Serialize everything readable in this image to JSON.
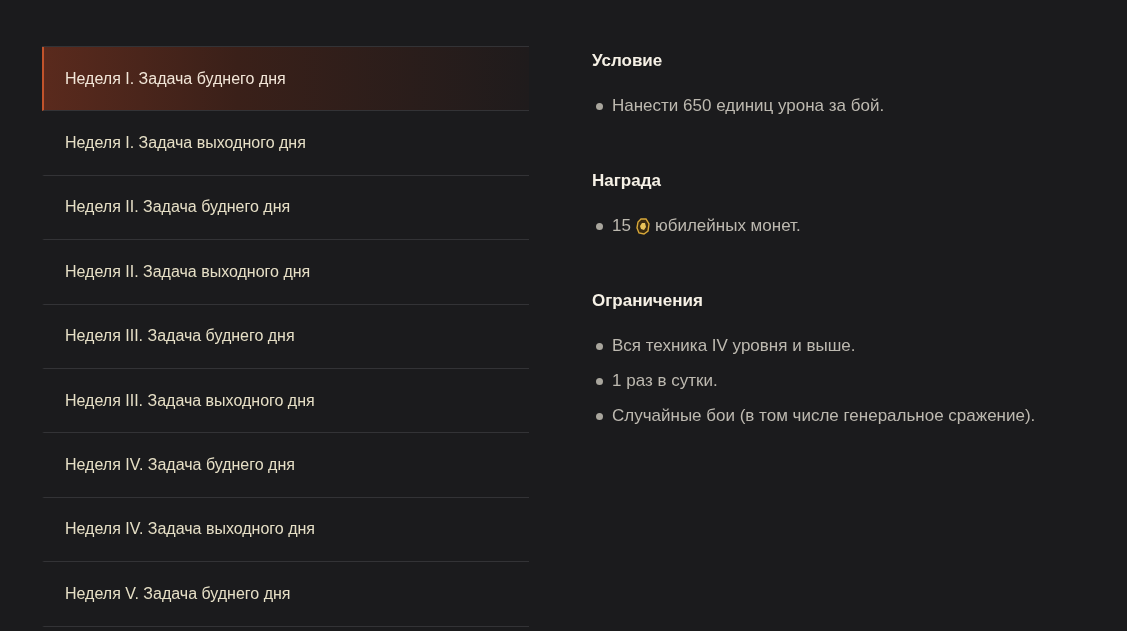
{
  "tasks": [
    {
      "label": "Неделя I. Задача буднего дня",
      "selected": true
    },
    {
      "label": "Неделя I. Задача выходного дня",
      "selected": false
    },
    {
      "label": "Неделя II. Задача буднего дня",
      "selected": false
    },
    {
      "label": "Неделя II. Задача выходного дня",
      "selected": false
    },
    {
      "label": "Неделя III. Задача буднего дня",
      "selected": false
    },
    {
      "label": "Неделя III. Задача выходного дня",
      "selected": false
    },
    {
      "label": "Неделя IV. Задача буднего дня",
      "selected": false
    },
    {
      "label": "Неделя IV. Задача выходного дня",
      "selected": false
    },
    {
      "label": "Неделя V. Задача буднего дня",
      "selected": false
    }
  ],
  "sections": [
    {
      "title": "Условие",
      "items": [
        {
          "kind": "text",
          "text": "Нанести 650 единиц урона за бой."
        }
      ]
    },
    {
      "title": "Награда",
      "items": [
        {
          "kind": "reward",
          "amount": "15",
          "text": "юбилейных монет."
        }
      ]
    },
    {
      "title": "Ограничения",
      "items": [
        {
          "kind": "text",
          "text": "Вся техника IV уровня и выше."
        },
        {
          "kind": "text",
          "text": "1 раз в сутки."
        },
        {
          "kind": "text",
          "text": "Случайные бои (в том числе генеральное сражение)."
        }
      ]
    }
  ]
}
